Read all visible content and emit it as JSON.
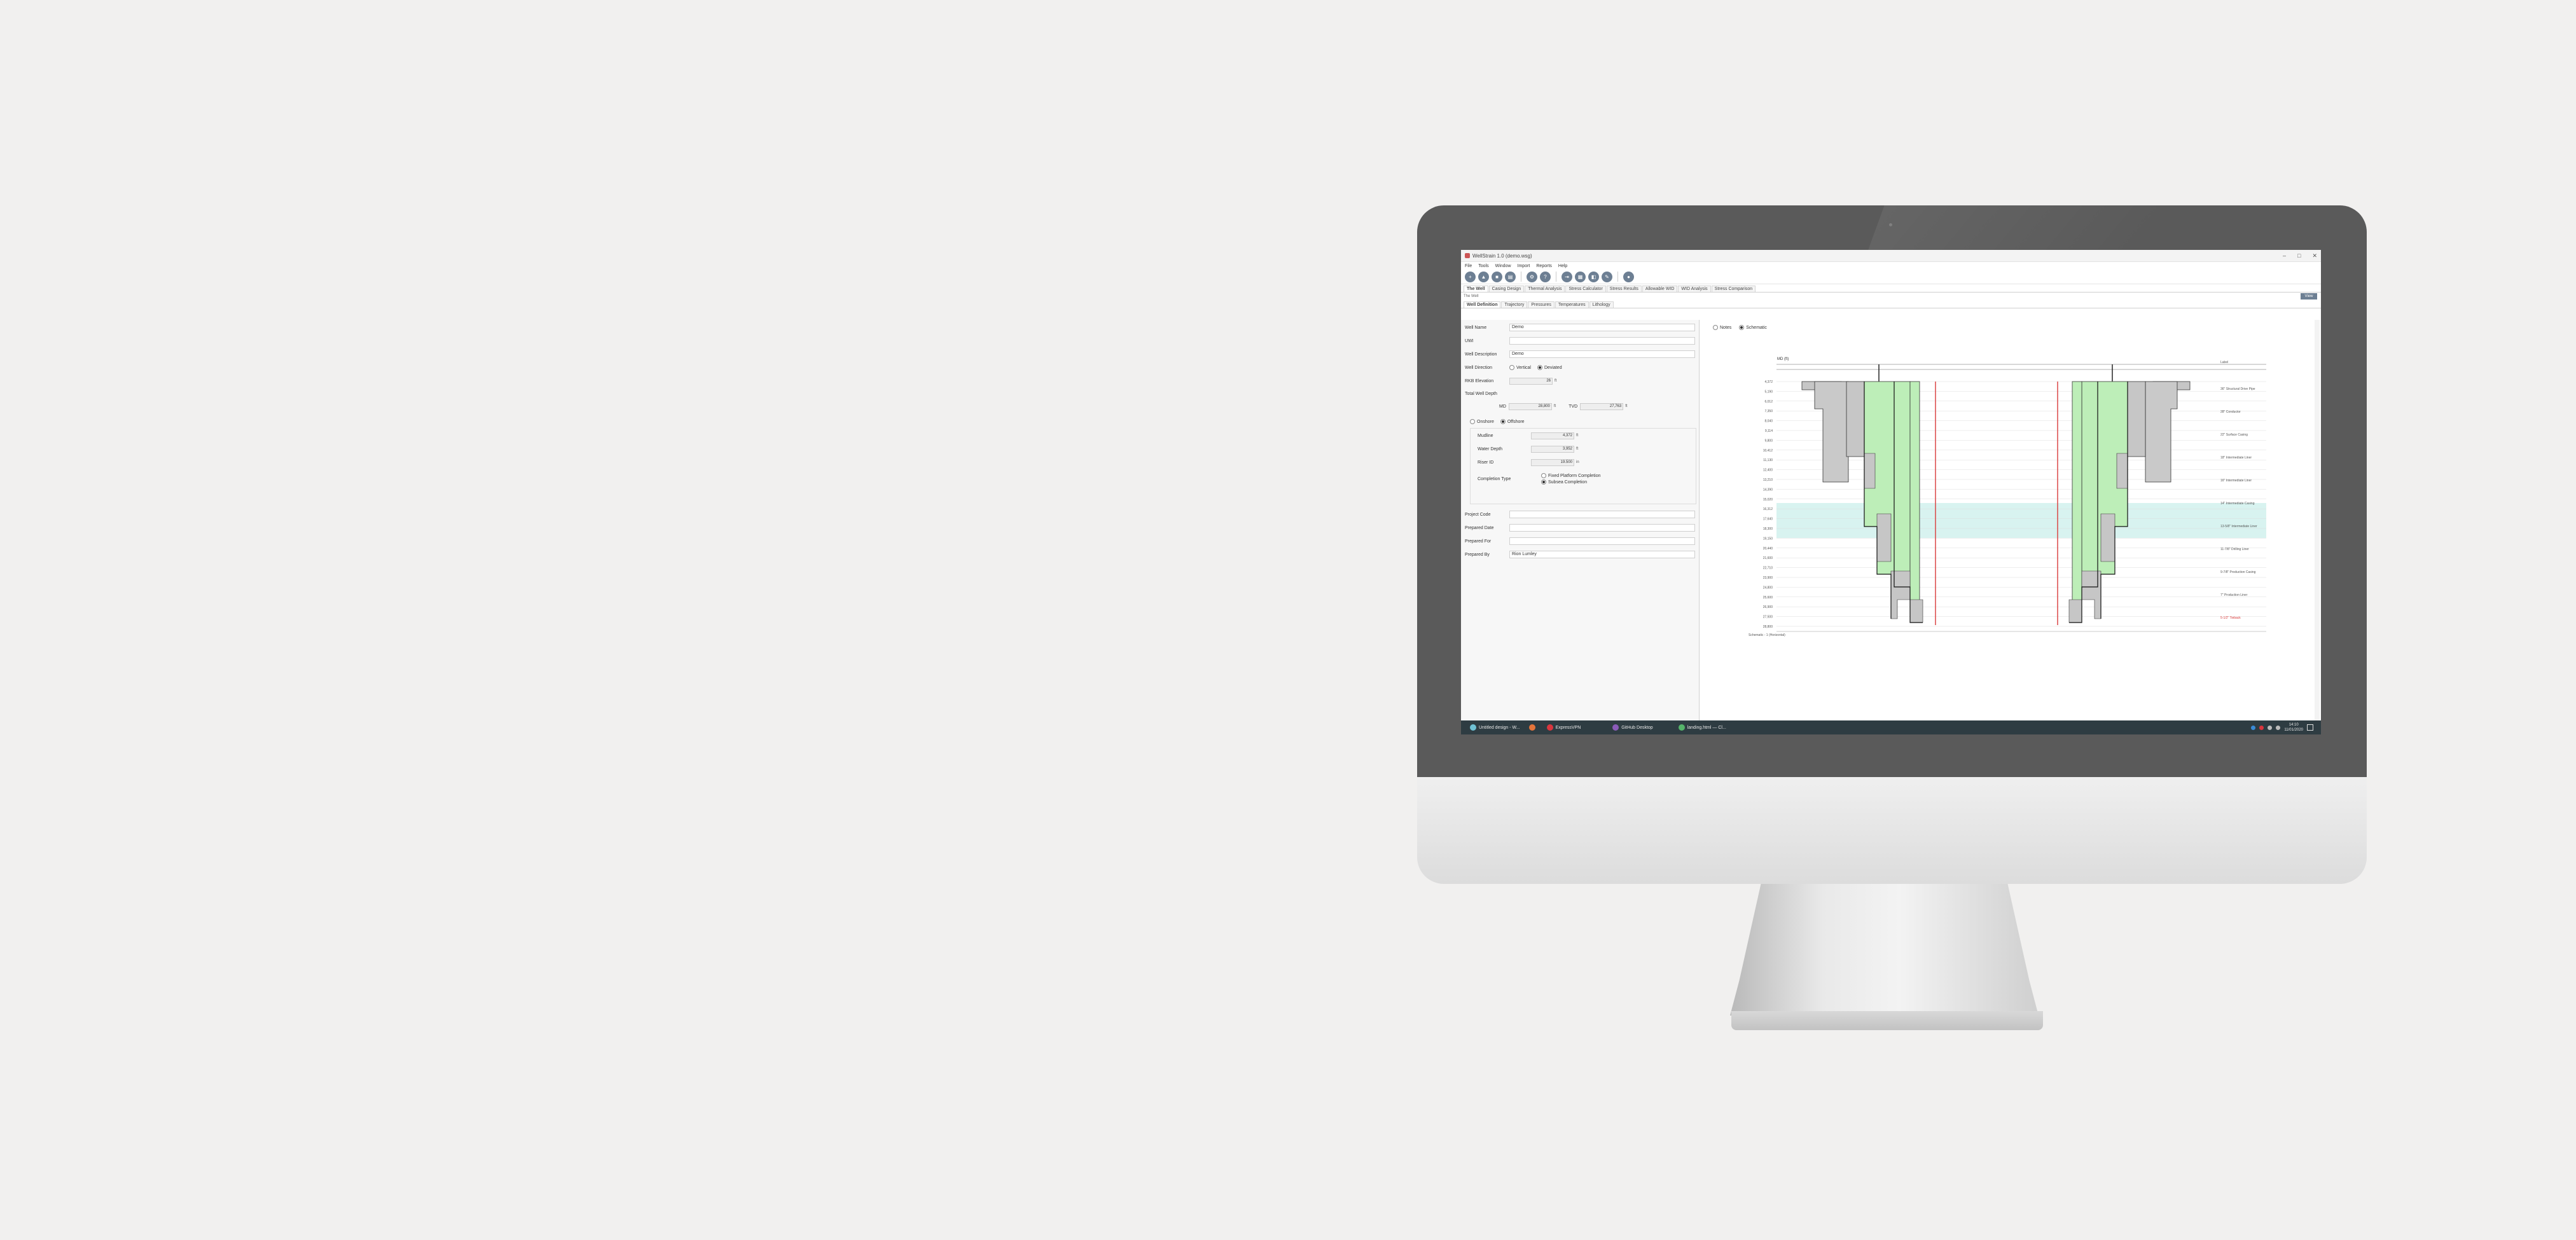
{
  "app": {
    "title": "WellStrain 1.0 (demo.wsg)",
    "window_controls": [
      "–",
      "□",
      "✕"
    ]
  },
  "menu": [
    "File",
    "Tools",
    "Window",
    "Import",
    "Reports",
    "Help"
  ],
  "toolbar_icons": [
    "new-icon",
    "open-icon",
    "save-icon",
    "print-icon",
    "settings-icon",
    "help-icon",
    "export-icon",
    "grid-icon",
    "chart-icon",
    "tools-icon",
    "user-icon"
  ],
  "main_tabs": [
    "The Well",
    "Casing Design",
    "Thermal Analysis",
    "Stress Calculator",
    "Stress Results",
    "Allowable WID",
    "WID Analysis",
    "Stress Comparison"
  ],
  "well_strip": {
    "label": "The Well",
    "view_button": "View"
  },
  "sub_tabs": [
    "Well Definition",
    "Trajectory",
    "Pressures",
    "Temperatures",
    "Lithology"
  ],
  "form": {
    "well_name": {
      "label": "Well Name",
      "value": "Demo"
    },
    "uwi": {
      "label": "UWI",
      "value": ""
    },
    "well_description": {
      "label": "Well Description",
      "value": "Demo"
    },
    "well_direction": {
      "label": "Well Direction",
      "options": [
        "Vertical",
        "Deviated"
      ],
      "selected": "Deviated"
    },
    "rkb_elevation": {
      "label": "RKB Elevation",
      "value": "26",
      "unit": "ft"
    },
    "total_well_depth": {
      "label": "Total Well Depth",
      "md_label": "MD",
      "md_value": "28,800",
      "md_unit": "ft",
      "tvd_label": "TVD",
      "tvd_value": "27,763",
      "tvd_unit": "ft"
    },
    "location": {
      "options": [
        "Onshore",
        "Offshore"
      ],
      "selected": "Offshore"
    },
    "mudline": {
      "label": "Mudline",
      "value": "4,372",
      "unit": "ft"
    },
    "water_depth": {
      "label": "Water Depth",
      "value": "3,952",
      "unit": "ft"
    },
    "riser_id": {
      "label": "Riser ID",
      "value": "19.500",
      "unit": "in"
    },
    "completion_type": {
      "label": "Completion Type",
      "options": [
        "Fixed Platform Completion",
        "Subsea Completion"
      ],
      "selected": "Subsea Completion"
    },
    "project_code": {
      "label": "Project Code",
      "value": ""
    },
    "prepared_date": {
      "label": "Prepared Date",
      "value": ""
    },
    "prepared_for": {
      "label": "Prepared For",
      "value": ""
    },
    "prepared_by": {
      "label": "Prepared By",
      "value": "Rion Lumley"
    }
  },
  "view_toggle": {
    "options": [
      "Notes",
      "Schematic"
    ],
    "selected": "Schematic"
  },
  "schematic": {
    "header_left": "MD (ft)",
    "header_right": "Label",
    "left_depth_labels": [
      "4,372",
      "5,190",
      "6,012",
      "7,350",
      "8,040",
      "9,114",
      "9,800",
      "10,412",
      "11,130",
      "12,400",
      "13,210",
      "14,390",
      "15,020",
      "16,312",
      "17,640",
      "18,300",
      "19,150",
      "20,440",
      "21,600",
      "22,710",
      "23,900",
      "24,800",
      "25,600",
      "26,900",
      "27,500",
      "28,800"
    ],
    "right_labels": [
      "36\" Structural Drive Pipe",
      "28\" Conductor",
      "22\" Surface Casing",
      "18\" Intermediate Liner",
      "16\" Intermediate Liner",
      "14\" Intermediate Casing",
      "13-5/8\" Intermediate Liner",
      "11-7/8\" Drilling Liner",
      "9-7/8\" Production Casing",
      "7\" Production Liner",
      "5-1/2\" Tieback"
    ],
    "footer": "Schematic - 1 (Horizontal)"
  },
  "taskbar": {
    "tasks": [
      "Untitled design - W...",
      "",
      "ExpressVPN",
      "GitHub Desktop",
      "landing.html — Cl..."
    ],
    "time": "14:10",
    "date": "11/01/2020"
  },
  "colors": {
    "bezel": "#5a5a5a",
    "accent": "#6d7f93",
    "cement_green": "#bdeeb8",
    "gray_fill": "#c6c6c6",
    "cyan_band": "#d8f3f0",
    "red_line": "#d93a3a",
    "taskbar": "#2e3c42"
  }
}
